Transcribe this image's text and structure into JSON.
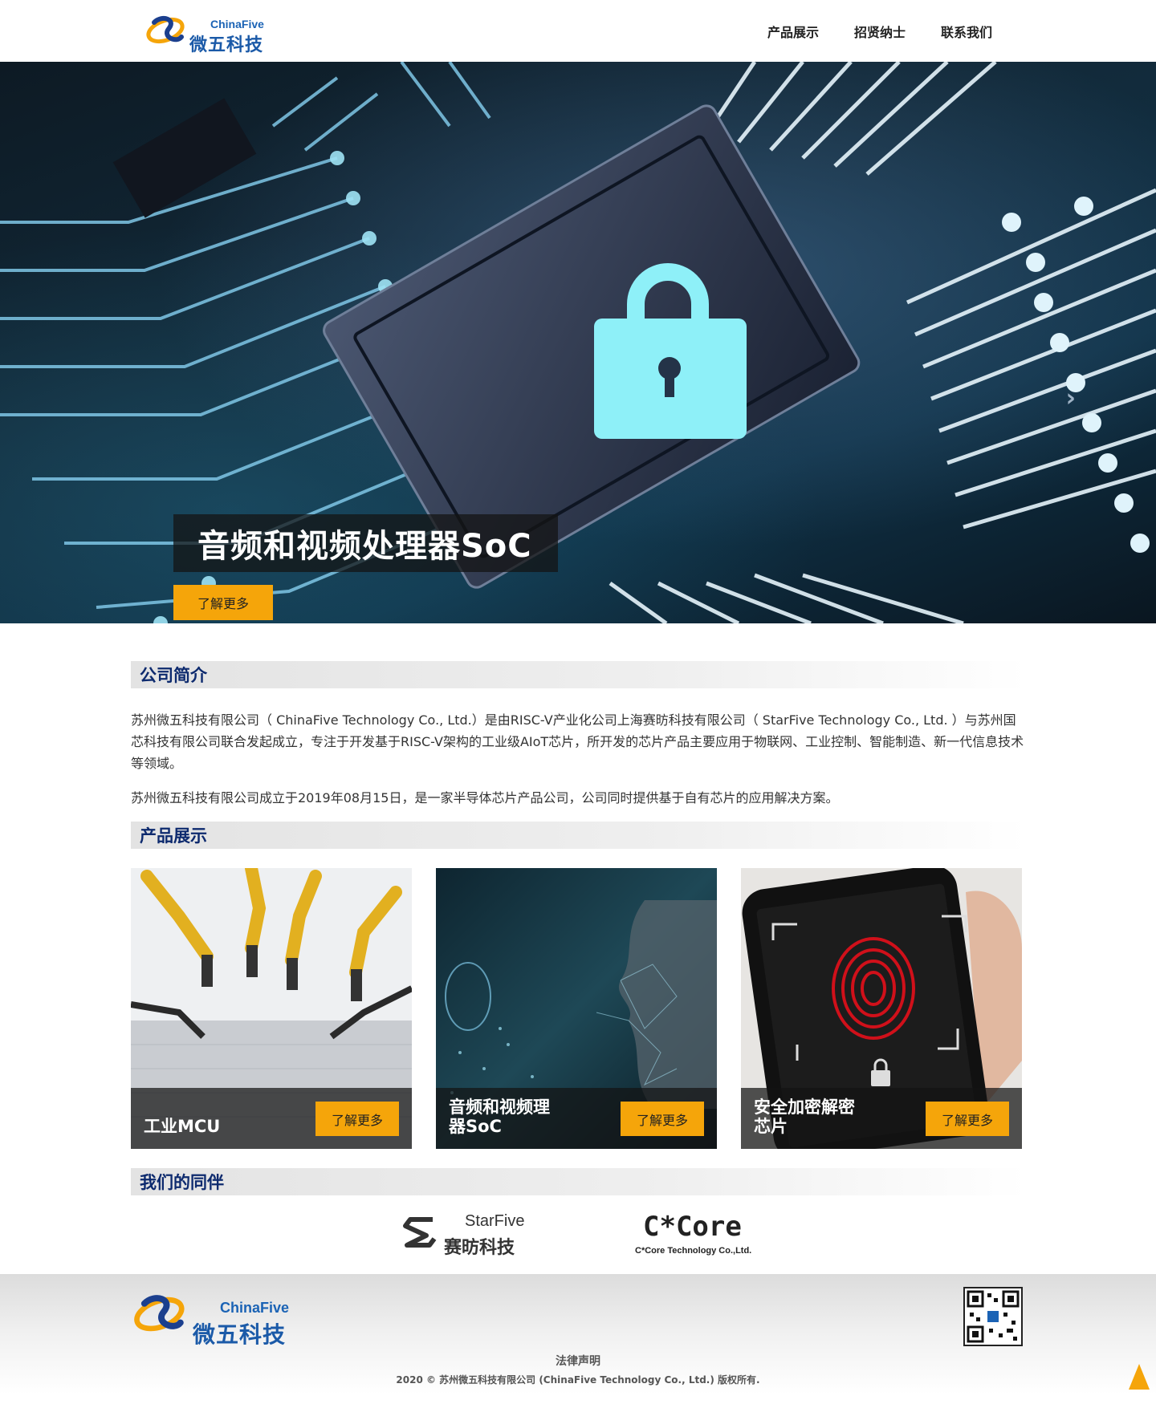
{
  "header": {
    "logo_en": "ChinaFive",
    "logo_cn": "微五科技",
    "nav": [
      {
        "label": "产品展示"
      },
      {
        "label": "招贤纳士"
      },
      {
        "label": "联系我们"
      }
    ]
  },
  "hero": {
    "caption": "音频和视频处理器SoC",
    "button": "了解更多",
    "slides_total": 4,
    "slide_active": 2,
    "next_arrow": "›"
  },
  "intro": {
    "title": "公司简介",
    "p1": "苏州微五科技有限公司（ ChinaFive Technology Co., Ltd.）是由RISC-V产业化公司上海赛昉科技有限公司（ StarFive Technology Co., Ltd. ）与苏州国芯科技有限公司联合发起成立，专注于开发基于RISC-V架构的工业级AIoT芯片，所开发的芯片产品主要应用于物联网、工业控制、智能制造、新一代信息技术等领域。",
    "p2": "苏州微五科技有限公司成立于2019年08月15日，是一家半导体芯片产品公司，公司同时提供基于自有芯片的应用解决方案。"
  },
  "products": {
    "title": "产品展示",
    "items": [
      {
        "title": "工业MCU",
        "button": "了解更多"
      },
      {
        "title": "音频和视频理器SoC",
        "button": "了解更多"
      },
      {
        "title": "安全加密解密芯片",
        "button": "了解更多"
      }
    ]
  },
  "partners": {
    "title": "我们的同伴",
    "items": [
      {
        "name_en": "StarFive",
        "name_cn": "赛昉科技"
      },
      {
        "name": "C*Core",
        "sub": "C*Core Technology Co.,Ltd."
      }
    ]
  },
  "footer": {
    "logo_en": "ChinaFive",
    "logo_cn": "微五科技",
    "legal": "法律声明",
    "copyright": "2020 © 苏州微五科技有限公司 (ChinaFive Technology Co., Ltd.) 版权所有."
  },
  "colors": {
    "accent": "#f5a50a",
    "brand_blue": "#1b5aa8",
    "title_navy": "#0d2a6e"
  }
}
